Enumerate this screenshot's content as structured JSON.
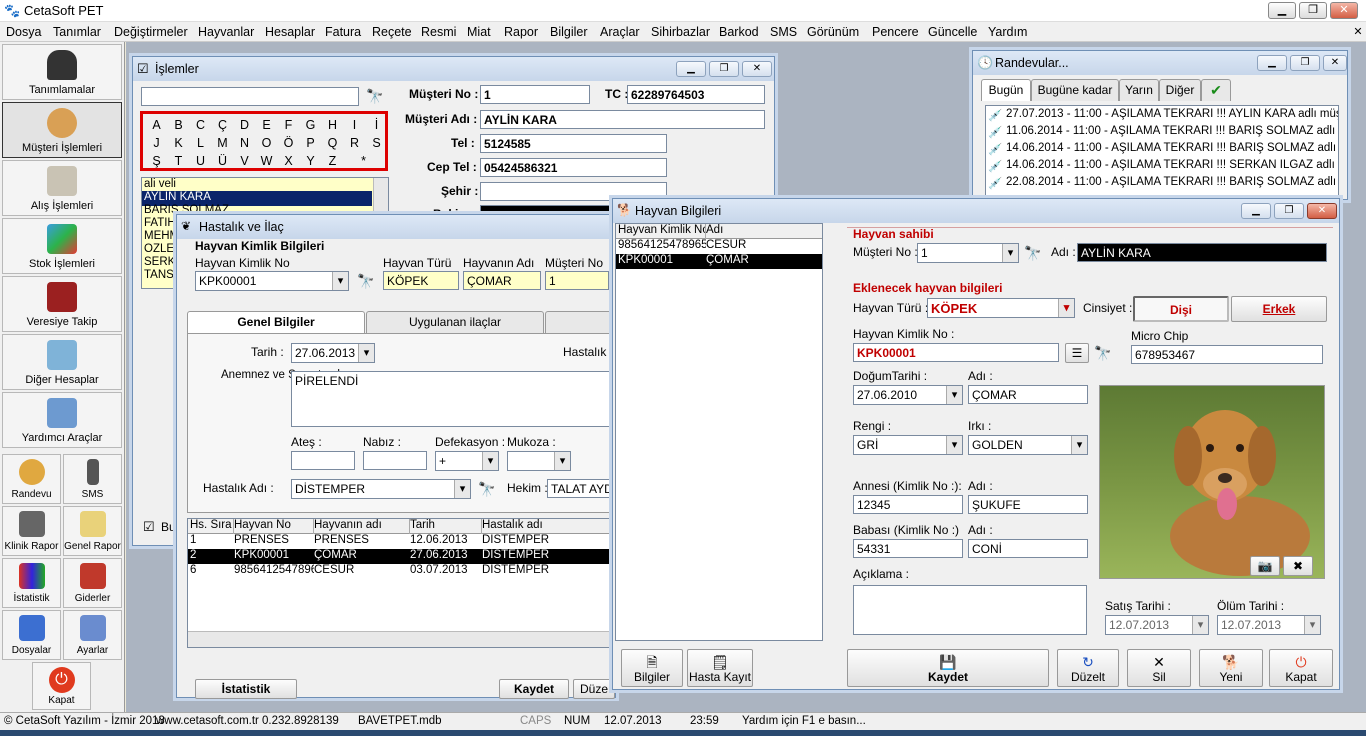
{
  "app": {
    "title": "CetaSoft PET"
  },
  "menu": [
    "Dosya",
    "Tanımlar",
    "Değiştirmeler",
    "Hayvanlar",
    "Hesaplar",
    "Fatura",
    "Reçete",
    "Resmi",
    "Miat",
    "Rapor",
    "Bilgiler",
    "Araçlar",
    "Sihirbazlar",
    "Barkod",
    "SMS",
    "Görünüm",
    "Pencere",
    "Güncelle",
    "Yardım"
  ],
  "sidebar": {
    "items": [
      "Tanımlamalar",
      "Müşteri İşlemleri",
      "Alış İşlemleri",
      "Stok İşlemleri",
      "Veresiye Takip",
      "Diğer Hesaplar",
      "Yardımcı Araçlar"
    ],
    "small": [
      "Randevu",
      "SMS",
      "Klinik Rapor",
      "Genel Rapor",
      "İstatistik",
      "Giderler",
      "Dosyalar",
      "Ayarlar",
      "Kapat"
    ]
  },
  "islemler": {
    "title": "İşlemler",
    "letters": [
      "A",
      "B",
      "C",
      "Ç",
      "D",
      "E",
      "F",
      "G",
      "H",
      "I",
      "İ",
      "J",
      "K",
      "L",
      "M",
      "N",
      "O",
      "Ö",
      "P",
      "Q",
      "R",
      "S",
      "Ş",
      "T",
      "U",
      "Ü",
      "V",
      "W",
      "X",
      "Y",
      "Z",
      "*"
    ],
    "list": [
      "ali veli",
      "AYLİN KARA",
      "BARIŞ SOLMAZ",
      "FATİH",
      "MEHM",
      "ÖZLEM",
      "SERKA",
      "TANSU"
    ],
    "musteri_no_label": "Müşteri No :",
    "musteri_no": "1",
    "tc_label": "TC :",
    "tc": "62289764503",
    "musteri_adi_label": "Müşteri Adı :",
    "musteri_adi": "AYLİN KARA",
    "tel_label": "Tel :",
    "tel": "5124585",
    "cep_label": "Cep Tel :",
    "cep": "05424586321",
    "sehir_label": "Şehir :",
    "sehir": "",
    "bakiye_label": "Bakiye :",
    "checkbox_label": "Bu"
  },
  "hastalik": {
    "title": "Hastalık ve İlaç",
    "group": "Hayvan Kimlik Bilgileri",
    "kimlik_label": "Hayvan Kimlik No",
    "kimlik": "KPK00001",
    "tur_label": "Hayvan Türü",
    "tur": "KÖPEK",
    "adi_label": "Hayvanın Adı",
    "adi": "ÇOMAR",
    "mno_label": "Müşteri No",
    "mno": "1",
    "tabs": [
      "Genel Bilgiler",
      "Uygulanan ilaçlar"
    ],
    "tarih_label": "Tarih :",
    "tarih": "27.06.2013",
    "hastalik_s": "Hastalık S",
    "anamnez_label": "Anemnez ve Semptomlar",
    "anamnez": "PİRELENDİ",
    "ates_label": "Ateş :",
    "nabiz_label": "Nabız :",
    "defekasyon_label": "Defekasyon :",
    "defekasyon": "+",
    "mukoza_label": "Mukoza :",
    "hastalik_adi_label": "Hastalık Adı :",
    "hastalik_adi": "DİSTEMPER",
    "hekim_label": "Hekim :",
    "hekim": "TALAT AYD",
    "table_headers": [
      "Hs. Sıra",
      "Hayvan No",
      "Hayvanın adı",
      "Tarih",
      "Hastalık adı"
    ],
    "rows": [
      [
        "1",
        "PRENSES",
        "PRENSES",
        "12.06.2013",
        "DİSTEMPER"
      ],
      [
        "2",
        "KPK00001",
        "ÇOMAR",
        "27.06.2013",
        "DİSTEMPER"
      ],
      [
        "6",
        "9856412547896",
        "CESUR",
        "03.07.2013",
        "DİSTEMPER"
      ]
    ],
    "buttons": [
      "İstatistik",
      "Kaydet",
      "Düze"
    ]
  },
  "randevular": {
    "title": "Randevular...",
    "tabs": [
      "Bugün",
      "Bugüne kadar",
      "Yarın",
      "Diğer"
    ],
    "items": [
      "27.07.2013 - 11:00 - AŞILAMA TEKRARI !!! AYLİN KARA adlı müşte...",
      "11.06.2014 - 11:00 - AŞILAMA TEKRARI !!! BARIŞ SOLMAZ adlı mü...",
      "14.06.2014 - 11:00 - AŞILAMA TEKRARI !!! BARIŞ SOLMAZ adlı mü...",
      "14.06.2014 - 11:00 - AŞILAMA TEKRARI !!! SERKAN ILGAZ adlı mü...",
      "22.08.2014 - 11:00 - AŞILAMA TEKRARI !!! BARIŞ SOLMAZ adlı mü..."
    ]
  },
  "hayvan": {
    "title": "Hayvan Bilgileri",
    "list_headers": [
      "Hayvan Kimlik No",
      "Adı"
    ],
    "list": [
      [
        "98564125478965",
        "CESUR"
      ],
      [
        "KPK00001",
        "ÇOMAR"
      ]
    ],
    "sahibi_title": "Hayvan sahibi",
    "mno_label": "Müşteri No :",
    "mno": "1",
    "adi_label": "Adı :",
    "adi": "AYLİN KARA",
    "eklenecek_title": "Eklenecek hayvan bilgileri",
    "tur_label": "Hayvan Türü :",
    "tur": "KÖPEK",
    "cinsiyet_label": "Cinsiyet :",
    "disi": "Dişi",
    "erkek": "Erkek",
    "kimlik_label": "Hayvan Kimlik No :",
    "kimlik": "KPK00001",
    "chip_label": "Micro Chip",
    "chip": "678953467",
    "dogum_label": "DoğumTarihi :",
    "dogum": "27.06.2010",
    "hadi_label": "Adı :",
    "hadi": "ÇOMAR",
    "renk_label": "Rengi :",
    "renk": "GRİ",
    "irk_label": "Irkı :",
    "irk": "GOLDEN",
    "anne_label": "Annesi (Kimlik No :):",
    "anne": "12345",
    "anne_adi_label": "Adı :",
    "anne_adi": "ŞUKUFE",
    "baba_label": "Babası (Kimlik No :)",
    "baba": "54331",
    "baba_adi_label": "Adı :",
    "baba_adi": "CONİ",
    "aciklama_label": "Açıklama :",
    "satis_label": "Satış Tarihi :",
    "satis": "12.07.2013",
    "olum_label": "Ölüm Tarihi :",
    "olum": "12.07.2013",
    "buttons": [
      "Bilgiler",
      "Hasta Kayıt",
      "Kaydet",
      "Düzelt",
      "Sil",
      "Yeni",
      "Kapat"
    ]
  },
  "status": [
    "© CetaSoft Yazılım - İzmir 2013",
    "www.cetasoft.com.tr",
    "0.232.8928139",
    "BAVETPET.mdb",
    "CAPS",
    "NUM",
    "12.07.2013",
    "23:59",
    "Yardım için F1 e basın..."
  ]
}
